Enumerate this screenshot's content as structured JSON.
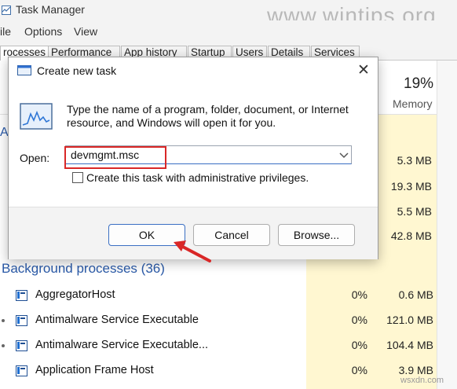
{
  "task_manager": {
    "title": "Task Manager",
    "menu": [
      "ile",
      "Options",
      "View"
    ],
    "tabs": [
      "rocesses",
      "Performance",
      "App history",
      "Startup",
      "Users",
      "Details",
      "Services"
    ],
    "memory_percent": "19%",
    "memory_label": "Memory",
    "partial_left_letter": "A",
    "apps_memory": [
      "5.3 MB",
      "19.3 MB",
      "5.5 MB",
      "42.8 MB"
    ],
    "background_header": "Background processes (36)",
    "processes": [
      {
        "name": "AggregatorHost",
        "cpu": "0%",
        "memory": "0.6 MB"
      },
      {
        "name": "Antimalware Service Executable",
        "cpu": "0%",
        "memory": "121.0 MB"
      },
      {
        "name": "Antimalware Service Executable...",
        "cpu": "0%",
        "memory": "104.4 MB"
      },
      {
        "name": "Application Frame Host",
        "cpu": "0%",
        "memory": "3.9 MB"
      }
    ]
  },
  "dialog": {
    "title": "Create new task",
    "description": "Type the name of a program, folder, document, or Internet resource, and Windows will open it for you.",
    "open_label": "Open:",
    "open_value": "devmgmt.msc",
    "admin_checkbox_label": "Create this task with administrative privileges.",
    "admin_checked": false,
    "ok_label": "OK",
    "cancel_label": "Cancel",
    "browse_label": "Browse..."
  },
  "watermark": {
    "top": "www.wintips.org",
    "bottom": "wsxdn.com"
  },
  "colors": {
    "memory_column": "#fff7d1",
    "highlight_box": "#d92727",
    "accent": "#3a6fc3",
    "section_header": "#2a5aa8"
  },
  "icons": [
    "task-manager-app-icon",
    "run-dialog-icon",
    "close-icon",
    "chevron-down-icon",
    "process-icon",
    "arrow-pointer-icon"
  ]
}
